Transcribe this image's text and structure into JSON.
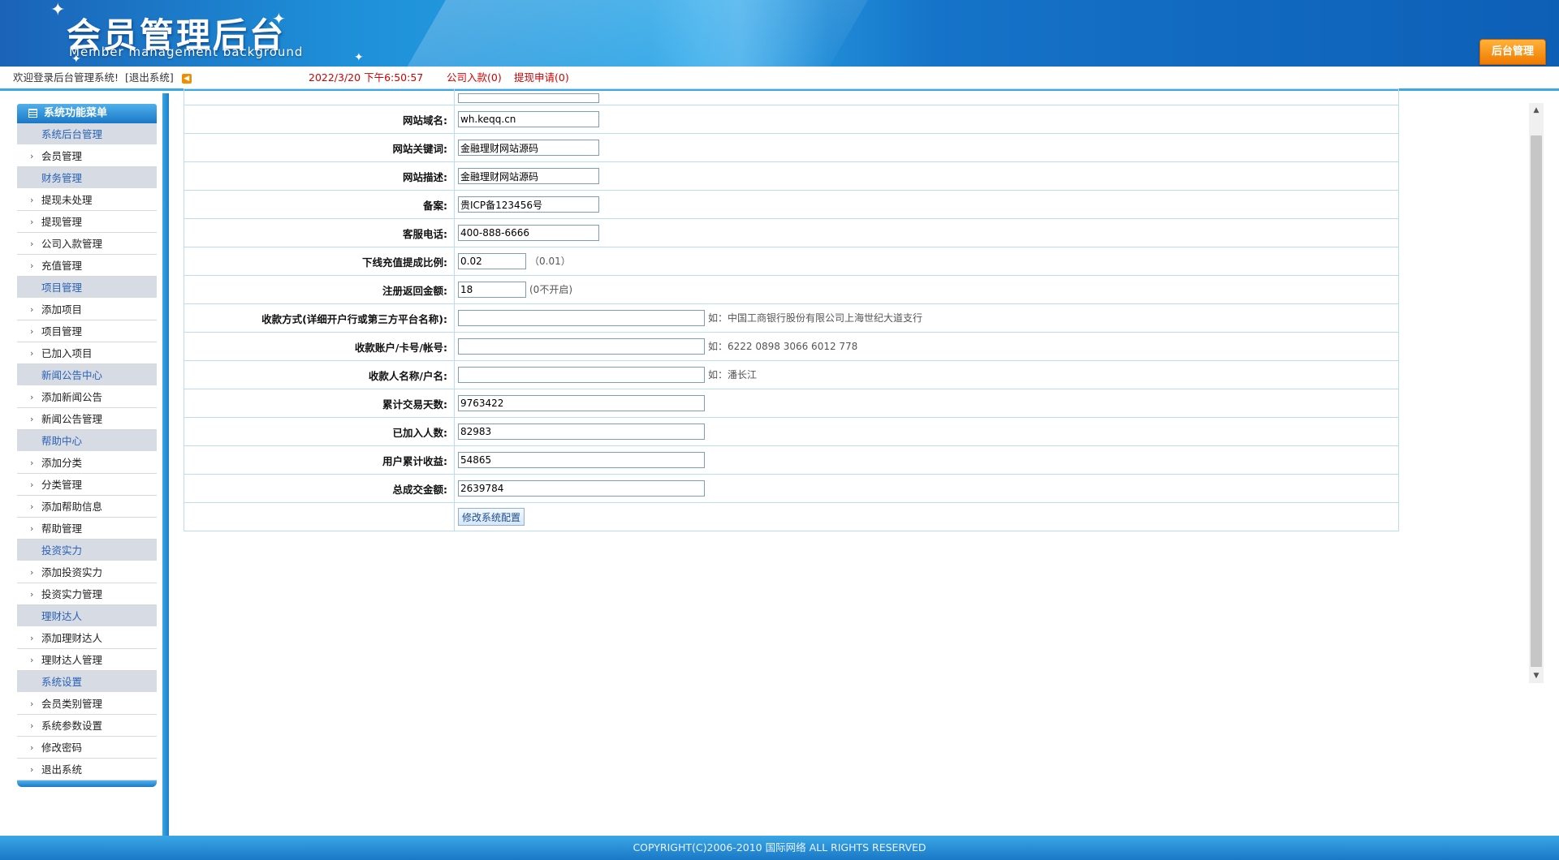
{
  "header": {
    "title": "会员管理后台",
    "subtitle": "Member management background",
    "admin_badge": "后台管理"
  },
  "infobar": {
    "welcome": "欢迎登录后台管理系统!",
    "exit": "[退出系统]",
    "datetime": "2022/3/20 下午6:50:57",
    "deposit": "公司入款(0)",
    "withdraw": "提现申请(0)"
  },
  "menu": {
    "header": "系统功能菜单",
    "items": [
      {
        "type": "group",
        "label": "系统后台管理"
      },
      {
        "type": "link",
        "label": "会员管理"
      },
      {
        "type": "group",
        "label": "财务管理"
      },
      {
        "type": "link",
        "label": "提现未处理"
      },
      {
        "type": "link",
        "label": "提现管理"
      },
      {
        "type": "link",
        "label": "公司入款管理"
      },
      {
        "type": "link",
        "label": "充值管理"
      },
      {
        "type": "group",
        "label": "项目管理"
      },
      {
        "type": "link",
        "label": "添加项目"
      },
      {
        "type": "link",
        "label": "项目管理"
      },
      {
        "type": "link",
        "label": "已加入项目"
      },
      {
        "type": "group",
        "label": "新闻公告中心"
      },
      {
        "type": "link",
        "label": "添加新闻公告"
      },
      {
        "type": "link",
        "label": "新闻公告管理"
      },
      {
        "type": "group",
        "label": "帮助中心"
      },
      {
        "type": "link",
        "label": "添加分类"
      },
      {
        "type": "link",
        "label": "分类管理"
      },
      {
        "type": "link",
        "label": "添加帮助信息"
      },
      {
        "type": "link",
        "label": "帮助管理"
      },
      {
        "type": "group",
        "label": "投资实力"
      },
      {
        "type": "link",
        "label": "添加投资实力"
      },
      {
        "type": "link",
        "label": "投资实力管理"
      },
      {
        "type": "group",
        "label": "理财达人"
      },
      {
        "type": "link",
        "label": "添加理财达人"
      },
      {
        "type": "link",
        "label": "理财达人管理"
      },
      {
        "type": "group",
        "label": "系统设置"
      },
      {
        "type": "link",
        "label": "会员类别管理"
      },
      {
        "type": "link",
        "label": "系统参数设置"
      },
      {
        "type": "link",
        "label": "修改密码"
      },
      {
        "type": "link",
        "label": "退出系统"
      }
    ]
  },
  "form": {
    "site_domain": {
      "label": "网站域名:",
      "value": "wh.keqq.cn"
    },
    "site_keywords": {
      "label": "网站关键词:",
      "value": "金融理财网站源码"
    },
    "site_desc": {
      "label": "网站描述:",
      "value": "金融理财网站源码"
    },
    "icp": {
      "label": "备案:",
      "value": "贵ICP备123456号"
    },
    "service_phone": {
      "label": "客服电话:",
      "value": "400-888-6666"
    },
    "commission_ratio": {
      "label": "下线充值提成比例:",
      "value": "0.02",
      "hint": "（0.01）"
    },
    "register_bonus": {
      "label": "注册返回金额:",
      "value": "18",
      "hint": "(0不开启)"
    },
    "payment_method": {
      "label": "收款方式(详细开户行或第三方平台名称):",
      "value": "",
      "hint": "如：中国工商银行股份有限公司上海世纪大道支行"
    },
    "payment_account": {
      "label": "收款账户/卡号/帐号:",
      "value": "",
      "hint": "如：6222 0898 3066 6012 778"
    },
    "payee_name": {
      "label": "收款人名称/户名:",
      "value": "",
      "hint": "如：潘长江"
    },
    "trade_days": {
      "label": "累计交易天数:",
      "value": "9763422"
    },
    "joined_count": {
      "label": "已加入人数:",
      "value": "82983"
    },
    "user_income": {
      "label": "用户累计收益:",
      "value": "54865"
    },
    "total_volume": {
      "label": "总成交金额:",
      "value": "2639784"
    },
    "submit_label": "修改系统配置"
  },
  "footer": {
    "copyright": "COPYRIGHT(C)2006-2010 国际网络 ALL RIGHTS RESERVED"
  }
}
